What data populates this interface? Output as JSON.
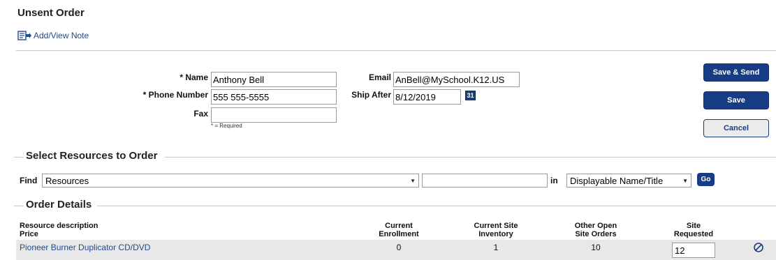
{
  "page": {
    "title": "Unsent Order",
    "note_link": "Add/View Note"
  },
  "form": {
    "name_label": "* Name",
    "name_value": "Anthony Bell",
    "phone_label": "* Phone Number",
    "phone_value": "555 555-5555",
    "fax_label": "Fax",
    "fax_value": "",
    "required_note": "* = Required",
    "email_label": "Email",
    "email_value": "AnBell@MySchool.K12.US",
    "ship_after_label": "Ship After",
    "ship_after_value": "8/12/2019",
    "calendar_text": "31"
  },
  "actions": {
    "save_send": "Save & Send",
    "save": "Save",
    "cancel": "Cancel"
  },
  "select_resources": {
    "heading": "Select Resources to Order",
    "find_label": "Find",
    "find_type": "Resources",
    "search_value": "",
    "in_label": "in",
    "search_field": "Displayable Name/Title",
    "go": "Go"
  },
  "order_details": {
    "heading": "Order Details",
    "columns": {
      "resource_desc": "Resource description",
      "price": "Price",
      "current_enrollment_1": "Current",
      "current_enrollment_2": "Enrollment",
      "site_inventory_1": "Current Site",
      "site_inventory_2": "Inventory",
      "other_orders_1": "Other Open",
      "other_orders_2": "Site Orders",
      "site_requested_1": "Site",
      "site_requested_2": "Requested"
    },
    "rows": [
      {
        "description": "Pioneer Burner Duplicator CD/DVD",
        "current_enrollment": "0",
        "site_inventory": "1",
        "other_open_orders": "10",
        "site_requested": "12"
      }
    ]
  },
  "colors": {
    "accent": "#173c84",
    "link": "#1f4b8f",
    "row_bg": "#e8e8e8"
  }
}
